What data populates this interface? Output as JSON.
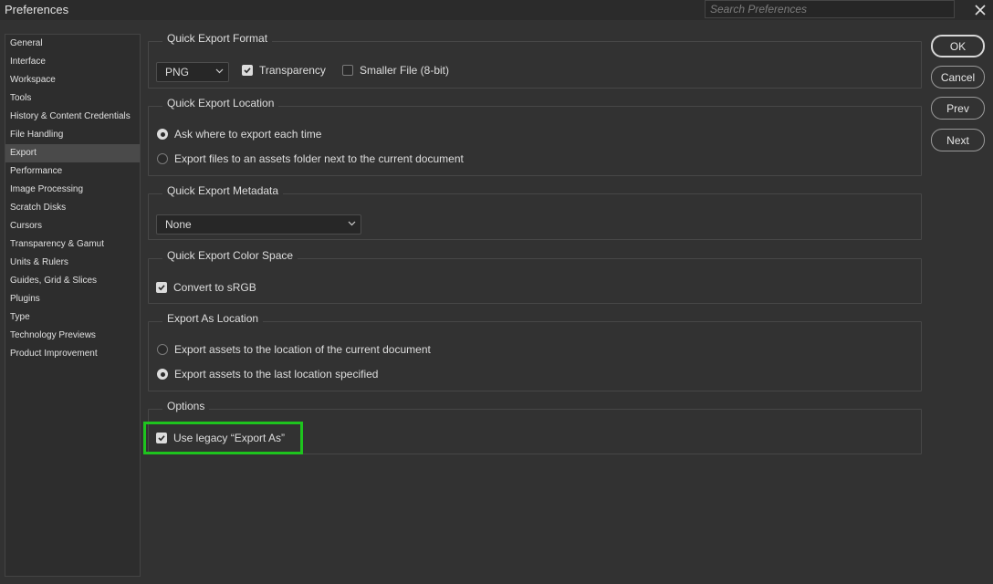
{
  "window": {
    "title": "Preferences"
  },
  "search": {
    "placeholder": "Search Preferences"
  },
  "sidebar": {
    "items": [
      "General",
      "Interface",
      "Workspace",
      "Tools",
      "History & Content Credentials",
      "File Handling",
      "Export",
      "Performance",
      "Image Processing",
      "Scratch Disks",
      "Cursors",
      "Transparency & Gamut",
      "Units & Rulers",
      "Guides, Grid & Slices",
      "Plugins",
      "Type",
      "Technology Previews",
      "Product Improvement"
    ],
    "active": "Export"
  },
  "quick_export_format": {
    "title": "Quick Export Format",
    "format_value": "PNG",
    "transparency_label": "Transparency",
    "transparency_checked": true,
    "smaller_file_label": "Smaller File (8-bit)",
    "smaller_file_checked": false
  },
  "quick_export_location": {
    "title": "Quick Export Location",
    "option_ask": "Ask where to export each time",
    "option_assets": "Export files to an assets folder next to the current document",
    "selected": "ask"
  },
  "quick_export_metadata": {
    "title": "Quick Export Metadata",
    "value": "None"
  },
  "quick_export_color_space": {
    "title": "Quick Export Color Space",
    "convert_label": "Convert to sRGB",
    "convert_checked": true
  },
  "export_as_location": {
    "title": "Export As Location",
    "option_current": "Export assets to the location of the current document",
    "option_last": "Export assets to the last location specified",
    "selected": "last"
  },
  "options": {
    "title": "Options",
    "legacy_label": "Use legacy “Export As”",
    "legacy_checked": true
  },
  "buttons": {
    "ok": "OK",
    "cancel": "Cancel",
    "prev": "Prev",
    "next": "Next"
  },
  "colors": {
    "highlight": "#1ec41e",
    "background": "#323232",
    "panel": "#2d2d2d"
  }
}
